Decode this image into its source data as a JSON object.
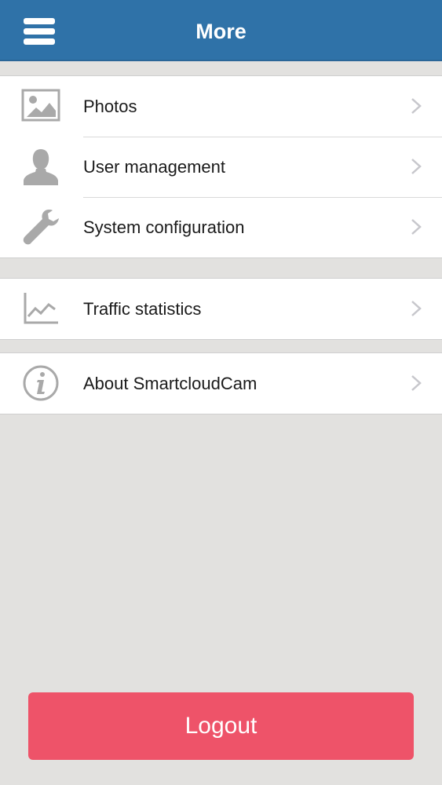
{
  "header": {
    "title": "More",
    "menu_icon": "hamburger-menu-icon"
  },
  "groups": [
    {
      "items": [
        {
          "label": "Photos",
          "icon": "photo-icon"
        },
        {
          "label": "User management",
          "icon": "user-icon"
        },
        {
          "label": "System configuration",
          "icon": "wrench-icon"
        }
      ]
    },
    {
      "items": [
        {
          "label": "Traffic statistics",
          "icon": "line-chart-icon"
        }
      ]
    },
    {
      "items": [
        {
          "label": "About SmartcloudCam",
          "icon": "info-icon"
        }
      ]
    }
  ],
  "logout": {
    "label": "Logout"
  },
  "colors": {
    "navbar": "#2f72a8",
    "background": "#e2e1df",
    "logout": "#ee5369",
    "icon": "#a9a9a9",
    "chevron": "#c7c7cc"
  }
}
